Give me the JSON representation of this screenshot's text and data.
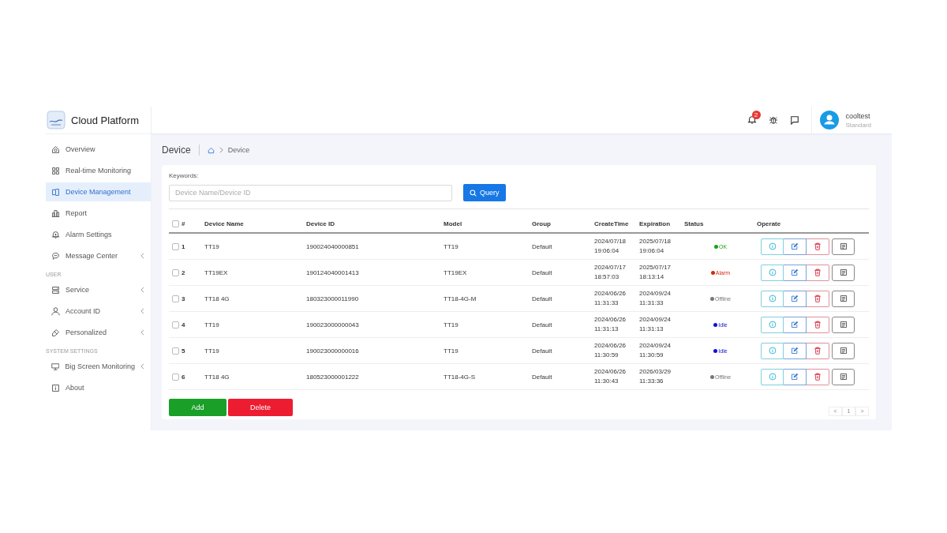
{
  "app": {
    "title": "Cloud Platform"
  },
  "header": {
    "notification_count": "2",
    "user": {
      "name": "cooltest",
      "role": "Standard"
    }
  },
  "sidebar": {
    "items": [
      {
        "kind": "item",
        "label": "Overview",
        "selected": false,
        "expandable": false
      },
      {
        "kind": "item",
        "label": "Real-time Monitoring",
        "selected": false,
        "expandable": false
      },
      {
        "kind": "item",
        "label": "Device Management",
        "selected": true,
        "expandable": false
      },
      {
        "kind": "item",
        "label": "Report",
        "selected": false,
        "expandable": false
      },
      {
        "kind": "item",
        "label": "Alarm Settings",
        "selected": false,
        "expandable": false
      },
      {
        "kind": "item",
        "label": "Message Center",
        "selected": false,
        "expandable": true
      },
      {
        "kind": "heading",
        "label": "USER"
      },
      {
        "kind": "item",
        "label": "Service",
        "selected": false,
        "expandable": true
      },
      {
        "kind": "item",
        "label": "Account ID",
        "selected": false,
        "expandable": true
      },
      {
        "kind": "item",
        "label": "Personalized",
        "selected": false,
        "expandable": true
      },
      {
        "kind": "heading",
        "label": "SYSTEM SETTINGS"
      },
      {
        "kind": "item",
        "label": "Big Screen Monitoring",
        "selected": false,
        "expandable": true
      },
      {
        "kind": "item",
        "label": "About",
        "selected": false,
        "expandable": false
      }
    ]
  },
  "page": {
    "title": "Device",
    "breadcrumb": [
      "Device"
    ]
  },
  "search": {
    "label": "Keywords:",
    "placeholder": "Device Name/Device ID",
    "button": "Query"
  },
  "table": {
    "all_checked": false,
    "columns": [
      "#",
      "Device Name",
      "Device ID",
      "Model",
      "Group",
      "CreateTime",
      "Expiration",
      "Status",
      "Operate"
    ],
    "rows": [
      {
        "checked": false,
        "index": "1",
        "name": "TT19",
        "device_id": "190024040000851",
        "model": "TT19",
        "group": "Default",
        "create_time": "2024/07/18 19:06:04",
        "expiration": "2025/07/18 19:06:04",
        "status": "OK",
        "color": "#18a318"
      },
      {
        "checked": false,
        "index": "2",
        "name": "TT19EX",
        "device_id": "190124040001413",
        "model": "TT19EX",
        "group": "Default",
        "create_time": "2024/07/17 18:57:03",
        "expiration": "2025/07/17 18:13:14",
        "status": "Alarm",
        "color": "#d42a12"
      },
      {
        "checked": false,
        "index": "3",
        "name": "TT18 4G",
        "device_id": "180323000011990",
        "model": "TT18-4G-M",
        "group": "Default",
        "create_time": "2024/06/26 11:31:33",
        "expiration": "2024/09/24 11:31:33",
        "status": "Offline",
        "color": "#777777"
      },
      {
        "checked": false,
        "index": "4",
        "name": "TT19",
        "device_id": "190023000000043",
        "model": "TT19",
        "group": "Default",
        "create_time": "2024/06/26 11:31:13",
        "expiration": "2024/09/24 11:31:13",
        "status": "Idle",
        "color": "#1010d8"
      },
      {
        "checked": false,
        "index": "5",
        "name": "TT19",
        "device_id": "190023000000016",
        "model": "TT19",
        "group": "Default",
        "create_time": "2024/06/26 11:30:59",
        "expiration": "2024/09/24 11:30:59",
        "status": "Idle",
        "color": "#1010d8"
      },
      {
        "checked": false,
        "index": "6",
        "name": "TT18 4G",
        "device_id": "180523000001222",
        "model": "TT18-4G-S",
        "group": "Default",
        "create_time": "2024/06/26 11:30:43",
        "expiration": "2026/03/29 11:33:36",
        "status": "Offline",
        "color": "#777777"
      }
    ]
  },
  "actions": [
    {
      "kind": "add",
      "label": "Add"
    },
    {
      "kind": "delete",
      "label": "Delete"
    }
  ],
  "pagination": {
    "prev": "<",
    "page": "1",
    "next": ">"
  }
}
